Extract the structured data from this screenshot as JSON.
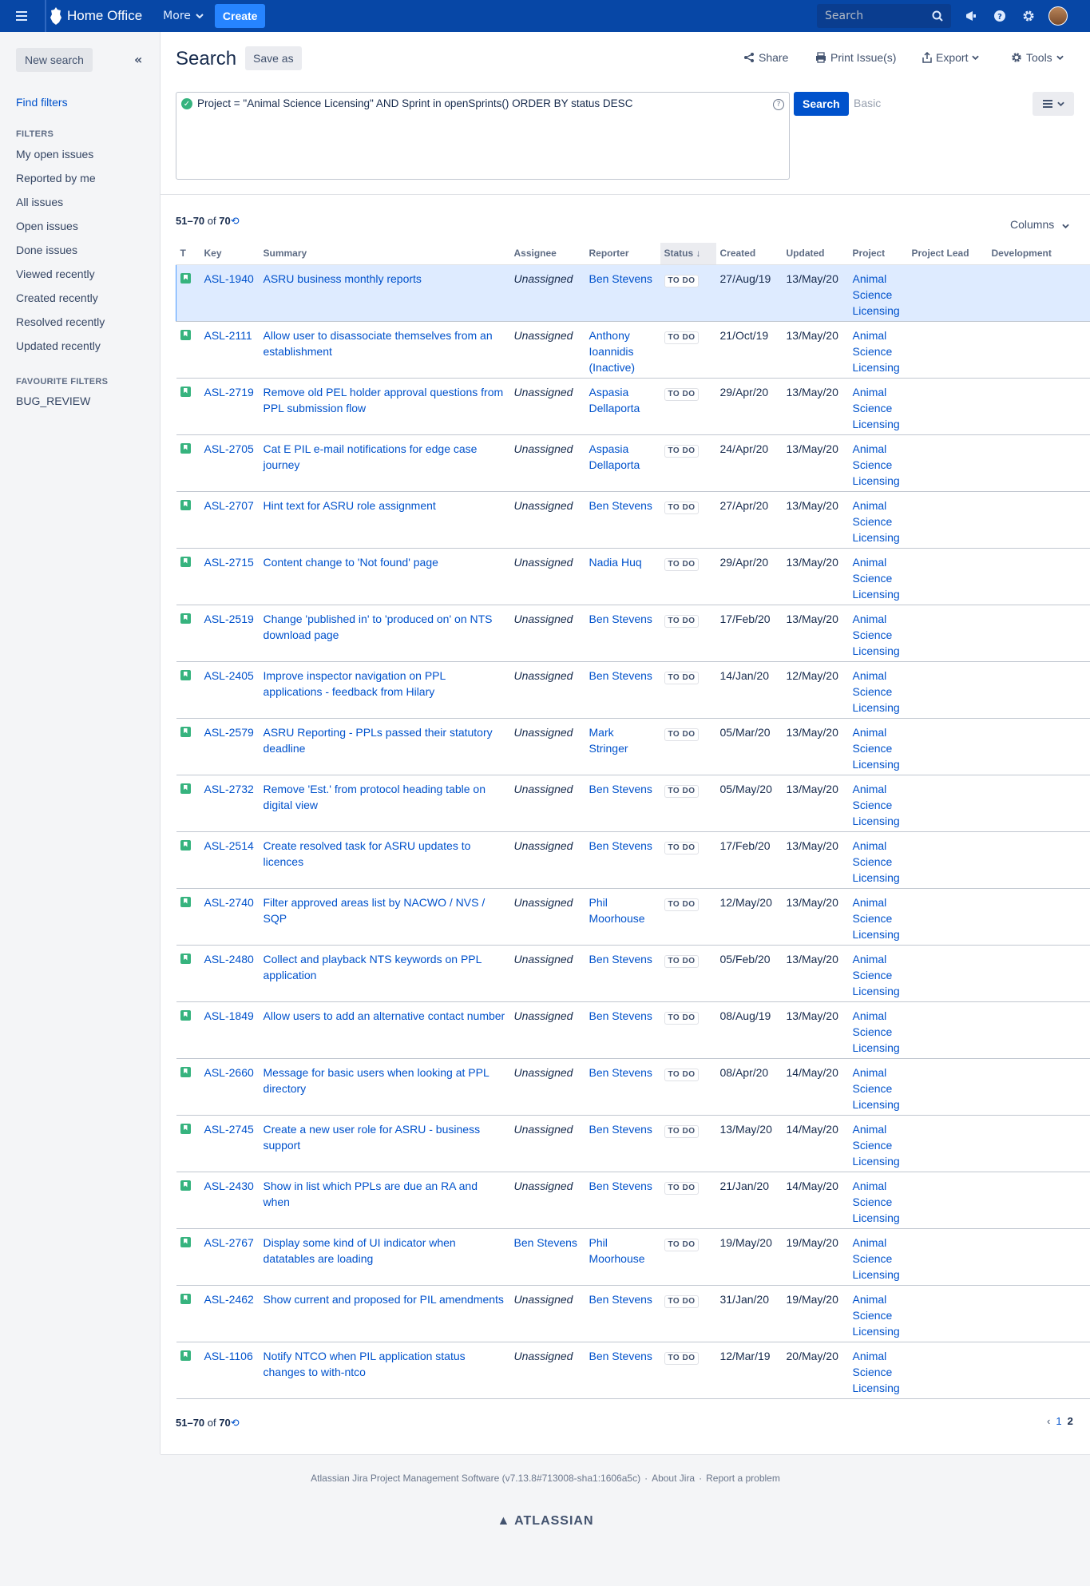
{
  "nav": {
    "brand": "Home Office",
    "more": "More",
    "create": "Create",
    "search_placeholder": "Search"
  },
  "sidebar": {
    "new_search": "New search",
    "find_filters": "Find filters",
    "filters_heading": "FILTERS",
    "filters": [
      "My open issues",
      "Reported by me",
      "All issues",
      "Open issues",
      "Done issues",
      "Viewed recently",
      "Created recently",
      "Resolved recently",
      "Updated recently"
    ],
    "favourite_heading": "FAVOURITE FILTERS",
    "favourites": [
      "BUG_REVIEW"
    ]
  },
  "header": {
    "title": "Search",
    "save_as": "Save as",
    "share": "Share",
    "print": "Print Issue(s)",
    "export": "Export",
    "tools": "Tools"
  },
  "query": {
    "jql": "Project = \"Animal Science Licensing\"  AND Sprint in openSprints() ORDER BY status DESC",
    "search_button": "Search",
    "basic": "Basic"
  },
  "results": {
    "range": "51–70",
    "of": "of",
    "total": "70",
    "columns_label": "Columns"
  },
  "table": {
    "headers": [
      "T",
      "Key",
      "Summary",
      "Assignee",
      "Reporter",
      "Status",
      "Created",
      "Updated",
      "Project",
      "Project Lead",
      "Development"
    ],
    "rows": [
      {
        "key": "ASL-1940",
        "summary": "ASRU business monthly reports",
        "assignee": "Unassigned",
        "reporter": "Ben Stevens",
        "status": "TO DO",
        "created": "27/Aug/19",
        "updated": "13/May/20",
        "project": "Animal Science Licensing"
      },
      {
        "key": "ASL-2111",
        "summary": "Allow user to disassociate themselves from an establishment",
        "assignee": "Unassigned",
        "reporter": "Anthony Ioannidis (Inactive)",
        "status": "TO DO",
        "created": "21/Oct/19",
        "updated": "13/May/20",
        "project": "Animal Science Licensing"
      },
      {
        "key": "ASL-2719",
        "summary": "Remove old PEL holder approval questions from PPL submission flow",
        "assignee": "Unassigned",
        "reporter": "Aspasia Dellaporta",
        "status": "TO DO",
        "created": "29/Apr/20",
        "updated": "13/May/20",
        "project": "Animal Science Licensing"
      },
      {
        "key": "ASL-2705",
        "summary": "Cat E PIL e-mail notifications for edge case journey",
        "assignee": "Unassigned",
        "reporter": "Aspasia Dellaporta",
        "status": "TO DO",
        "created": "24/Apr/20",
        "updated": "13/May/20",
        "project": "Animal Science Licensing"
      },
      {
        "key": "ASL-2707",
        "summary": "Hint text for ASRU role assignment",
        "assignee": "Unassigned",
        "reporter": "Ben Stevens",
        "status": "TO DO",
        "created": "27/Apr/20",
        "updated": "13/May/20",
        "project": "Animal Science Licensing"
      },
      {
        "key": "ASL-2715",
        "summary": "Content change to 'Not found' page",
        "assignee": "Unassigned",
        "reporter": "Nadia Huq",
        "status": "TO DO",
        "created": "29/Apr/20",
        "updated": "13/May/20",
        "project": "Animal Science Licensing"
      },
      {
        "key": "ASL-2519",
        "summary": "Change 'published in' to 'produced on' on NTS download page",
        "assignee": "Unassigned",
        "reporter": "Ben Stevens",
        "status": "TO DO",
        "created": "17/Feb/20",
        "updated": "13/May/20",
        "project": "Animal Science Licensing"
      },
      {
        "key": "ASL-2405",
        "summary": "Improve inspector navigation on PPL applications - feedback from Hilary",
        "assignee": "Unassigned",
        "reporter": "Ben Stevens",
        "status": "TO DO",
        "created": "14/Jan/20",
        "updated": "12/May/20",
        "project": "Animal Science Licensing"
      },
      {
        "key": "ASL-2579",
        "summary": "ASRU Reporting - PPLs passed their statutory deadline",
        "assignee": "Unassigned",
        "reporter": "Mark Stringer",
        "status": "TO DO",
        "created": "05/Mar/20",
        "updated": "13/May/20",
        "project": "Animal Science Licensing"
      },
      {
        "key": "ASL-2732",
        "summary": "Remove 'Est.' from protocol heading table on digital view",
        "assignee": "Unassigned",
        "reporter": "Ben Stevens",
        "status": "TO DO",
        "created": "05/May/20",
        "updated": "13/May/20",
        "project": "Animal Science Licensing"
      },
      {
        "key": "ASL-2514",
        "summary": "Create resolved task for ASRU updates to licences",
        "assignee": "Unassigned",
        "reporter": "Ben Stevens",
        "status": "TO DO",
        "created": "17/Feb/20",
        "updated": "13/May/20",
        "project": "Animal Science Licensing"
      },
      {
        "key": "ASL-2740",
        "summary": "Filter approved areas list by NACWO / NVS / SQP",
        "assignee": "Unassigned",
        "reporter": "Phil Moorhouse",
        "status": "TO DO",
        "created": "12/May/20",
        "updated": "13/May/20",
        "project": "Animal Science Licensing"
      },
      {
        "key": "ASL-2480",
        "summary": "Collect and playback NTS keywords on PPL application",
        "assignee": "Unassigned",
        "reporter": "Ben Stevens",
        "status": "TO DO",
        "created": "05/Feb/20",
        "updated": "13/May/20",
        "project": "Animal Science Licensing"
      },
      {
        "key": "ASL-1849",
        "summary": "Allow users to add an alternative contact number",
        "assignee": "Unassigned",
        "reporter": "Ben Stevens",
        "status": "TO DO",
        "created": "08/Aug/19",
        "updated": "13/May/20",
        "project": "Animal Science Licensing"
      },
      {
        "key": "ASL-2660",
        "summary": "Message for basic users when looking at PPL directory",
        "assignee": "Unassigned",
        "reporter": "Ben Stevens",
        "status": "TO DO",
        "created": "08/Apr/20",
        "updated": "14/May/20",
        "project": "Animal Science Licensing"
      },
      {
        "key": "ASL-2745",
        "summary": "Create a new user role for ASRU - business support",
        "assignee": "Unassigned",
        "reporter": "Ben Stevens",
        "status": "TO DO",
        "created": "13/May/20",
        "updated": "14/May/20",
        "project": "Animal Science Licensing"
      },
      {
        "key": "ASL-2430",
        "summary": "Show in list which PPLs are due an RA and when",
        "assignee": "Unassigned",
        "reporter": "Ben Stevens",
        "status": "TO DO",
        "created": "21/Jan/20",
        "updated": "14/May/20",
        "project": "Animal Science Licensing"
      },
      {
        "key": "ASL-2767",
        "summary": "Display some kind of UI indicator when datatables are loading",
        "assignee": "Ben Stevens",
        "reporter": "Phil Moorhouse",
        "status": "TO DO",
        "created": "19/May/20",
        "updated": "19/May/20",
        "project": "Animal Science Licensing"
      },
      {
        "key": "ASL-2462",
        "summary": "Show current and proposed for PIL amendments",
        "assignee": "Unassigned",
        "reporter": "Ben Stevens",
        "status": "TO DO",
        "created": "31/Jan/20",
        "updated": "19/May/20",
        "project": "Animal Science Licensing"
      },
      {
        "key": "ASL-1106",
        "summary": "Notify NTCO when PIL application status changes to with-ntco",
        "assignee": "Unassigned",
        "reporter": "Ben Stevens",
        "status": "TO DO",
        "created": "12/Mar/19",
        "updated": "20/May/20",
        "project": "Animal Science Licensing"
      }
    ]
  },
  "pagination": {
    "pages": [
      "1",
      "2"
    ]
  },
  "footer": {
    "version": "Atlassian Jira Project Management Software (v7.13.8#713008-sha1:1606a5c)",
    "about": "About Jira",
    "report": "Report a problem",
    "brand": "ATLASSIAN"
  }
}
